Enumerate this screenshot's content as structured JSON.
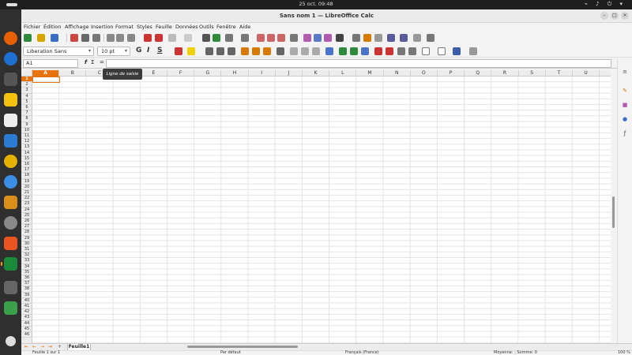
{
  "system": {
    "clock": "25 oct.  09:48",
    "status_icons": "⌁ ♪ ⏻ ▾"
  },
  "window": {
    "title": "Sans nom 1 — LibreOffice Calc"
  },
  "menu": [
    "Fichier",
    "Édition",
    "Affichage",
    "Insertion",
    "Format",
    "Styles",
    "Feuille",
    "Données",
    "Outils",
    "Fenêtre",
    "Aide"
  ],
  "toolbar2": {
    "font_name": "Liberation Sans",
    "font_size": "10 pt",
    "bold": "G",
    "italic": "I",
    "underline": "S"
  },
  "formula": {
    "name_box": "A1",
    "fx": "f",
    "sigma": "Σ",
    "equals": "=",
    "tooltip": "Ligne de saisie"
  },
  "columns": [
    "A",
    "B",
    "C",
    "D",
    "E",
    "F",
    "G",
    "H",
    "I",
    "J",
    "K",
    "L",
    "M",
    "N",
    "O",
    "P",
    "Q",
    "R",
    "S",
    "T",
    "U"
  ],
  "rows": [
    "1",
    "2",
    "3",
    "4",
    "5",
    "6",
    "7",
    "8",
    "9",
    "10",
    "11",
    "12",
    "13",
    "14",
    "15",
    "16",
    "17",
    "18",
    "19",
    "20",
    "21",
    "22",
    "23",
    "24",
    "25",
    "26",
    "27",
    "28",
    "29",
    "30",
    "31",
    "32",
    "33",
    "34",
    "35",
    "36",
    "37",
    "38",
    "39",
    "40",
    "41",
    "42",
    "43",
    "44",
    "45",
    "46"
  ],
  "sheets": {
    "active_tab": "Feuille1"
  },
  "statusbar": {
    "sheet": "Feuille 1 sur 1",
    "style": "Par défaut",
    "language": "Français (France)",
    "summary": "Moyenne: ; Somme: 0",
    "zoom": "100 %"
  },
  "colors": {
    "accent": "#e8720c"
  }
}
